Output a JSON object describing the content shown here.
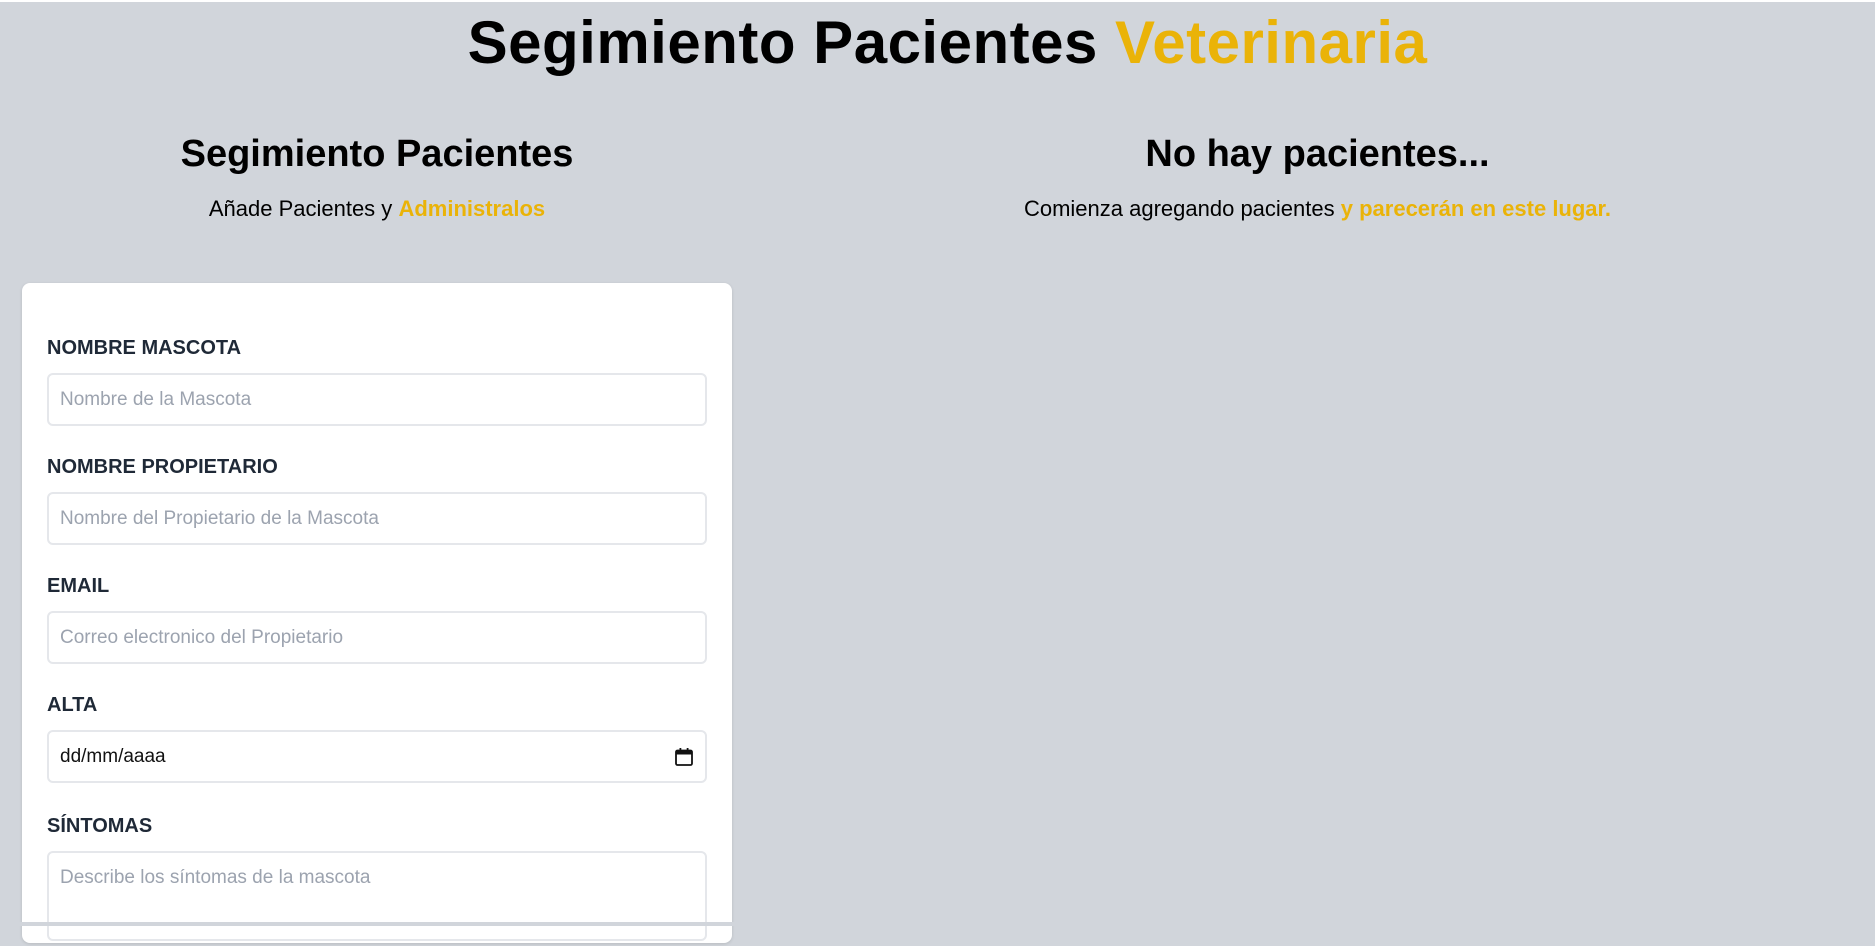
{
  "header": {
    "title_main": "Segimiento Pacientes",
    "title_accent": "Veterinaria"
  },
  "form_section": {
    "title": "Segimiento Pacientes",
    "subtitle_text": "Añade Pacientes y",
    "subtitle_accent": "Administralos"
  },
  "list_section": {
    "title": "No hay pacientes...",
    "subtitle_text": "Comienza agregando pacientes",
    "subtitle_accent": "y parecerán en este lugar."
  },
  "form": {
    "pet_name": {
      "label": "NOMBRE MASCOTA",
      "placeholder": "Nombre de la Mascota",
      "value": ""
    },
    "owner_name": {
      "label": "NOMBRE PROPIETARIO",
      "placeholder": "Nombre del Propietario de la Mascota",
      "value": ""
    },
    "email": {
      "label": "EMAIL",
      "placeholder": "Correo electronico del Propietario",
      "value": ""
    },
    "discharge": {
      "label": "ALTA",
      "value": "dd/mm/aaaa",
      "icon": "calendar-icon"
    },
    "symptoms": {
      "label": "SÍNTOMAS",
      "placeholder": "Describe los síntomas de la mascota",
      "value": ""
    }
  },
  "colors": {
    "accent": "#eab308",
    "background": "#d1d5db",
    "card": "#ffffff"
  }
}
